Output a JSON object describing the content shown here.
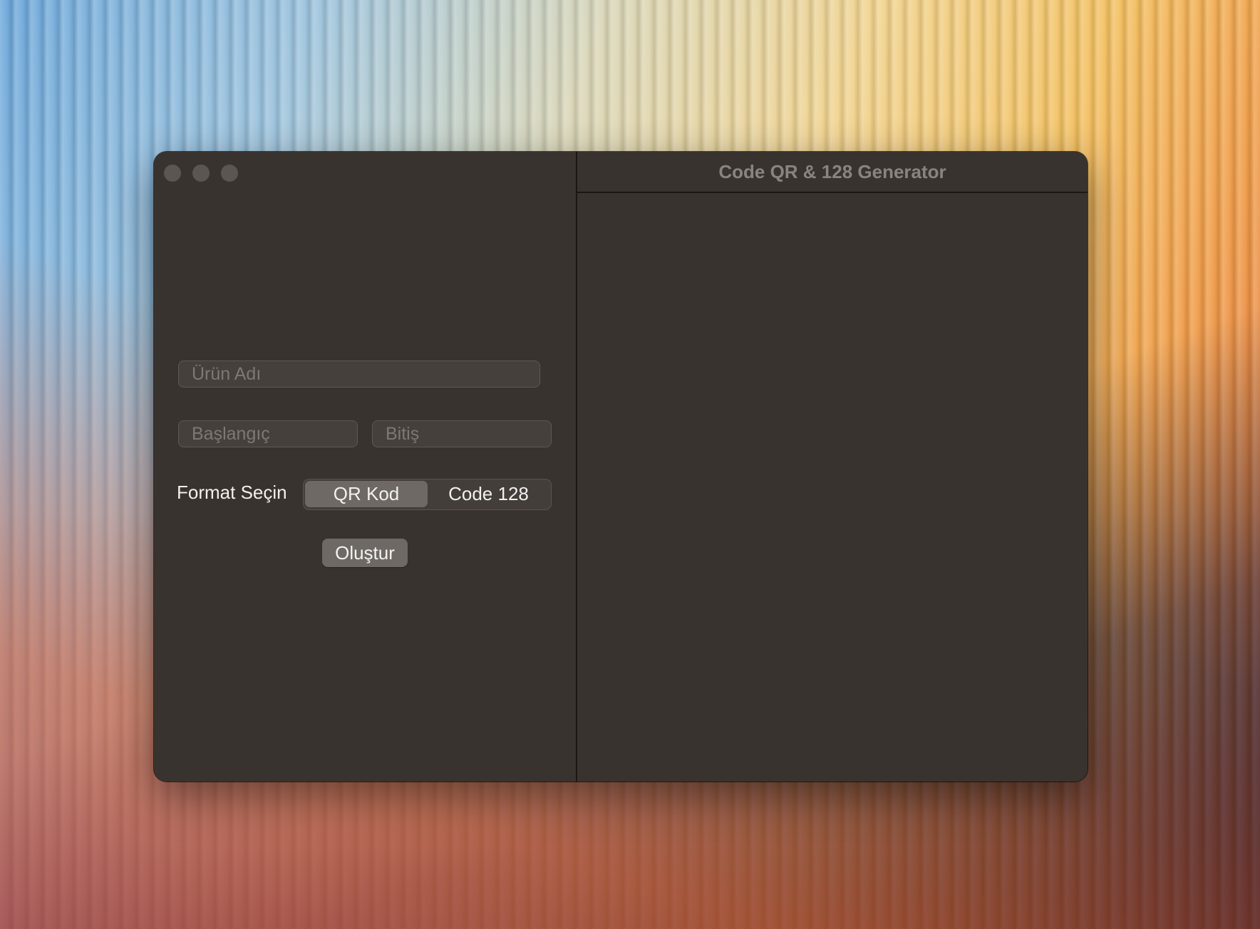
{
  "window": {
    "title": "Code QR & 128 Generator"
  },
  "form": {
    "product_name_placeholder": "Ürün Adı",
    "start_placeholder": "Başlangıç",
    "end_placeholder": "Bitiş",
    "format_label": "Format Seçin",
    "format_options": [
      "QR Kod",
      "Code 128"
    ],
    "format_selected": "QR Kod",
    "create_button": "Oluştur"
  },
  "colors": {
    "window_bg": "#39332f",
    "selected_segment": "#6e6965",
    "title_text": "#8a8480"
  }
}
